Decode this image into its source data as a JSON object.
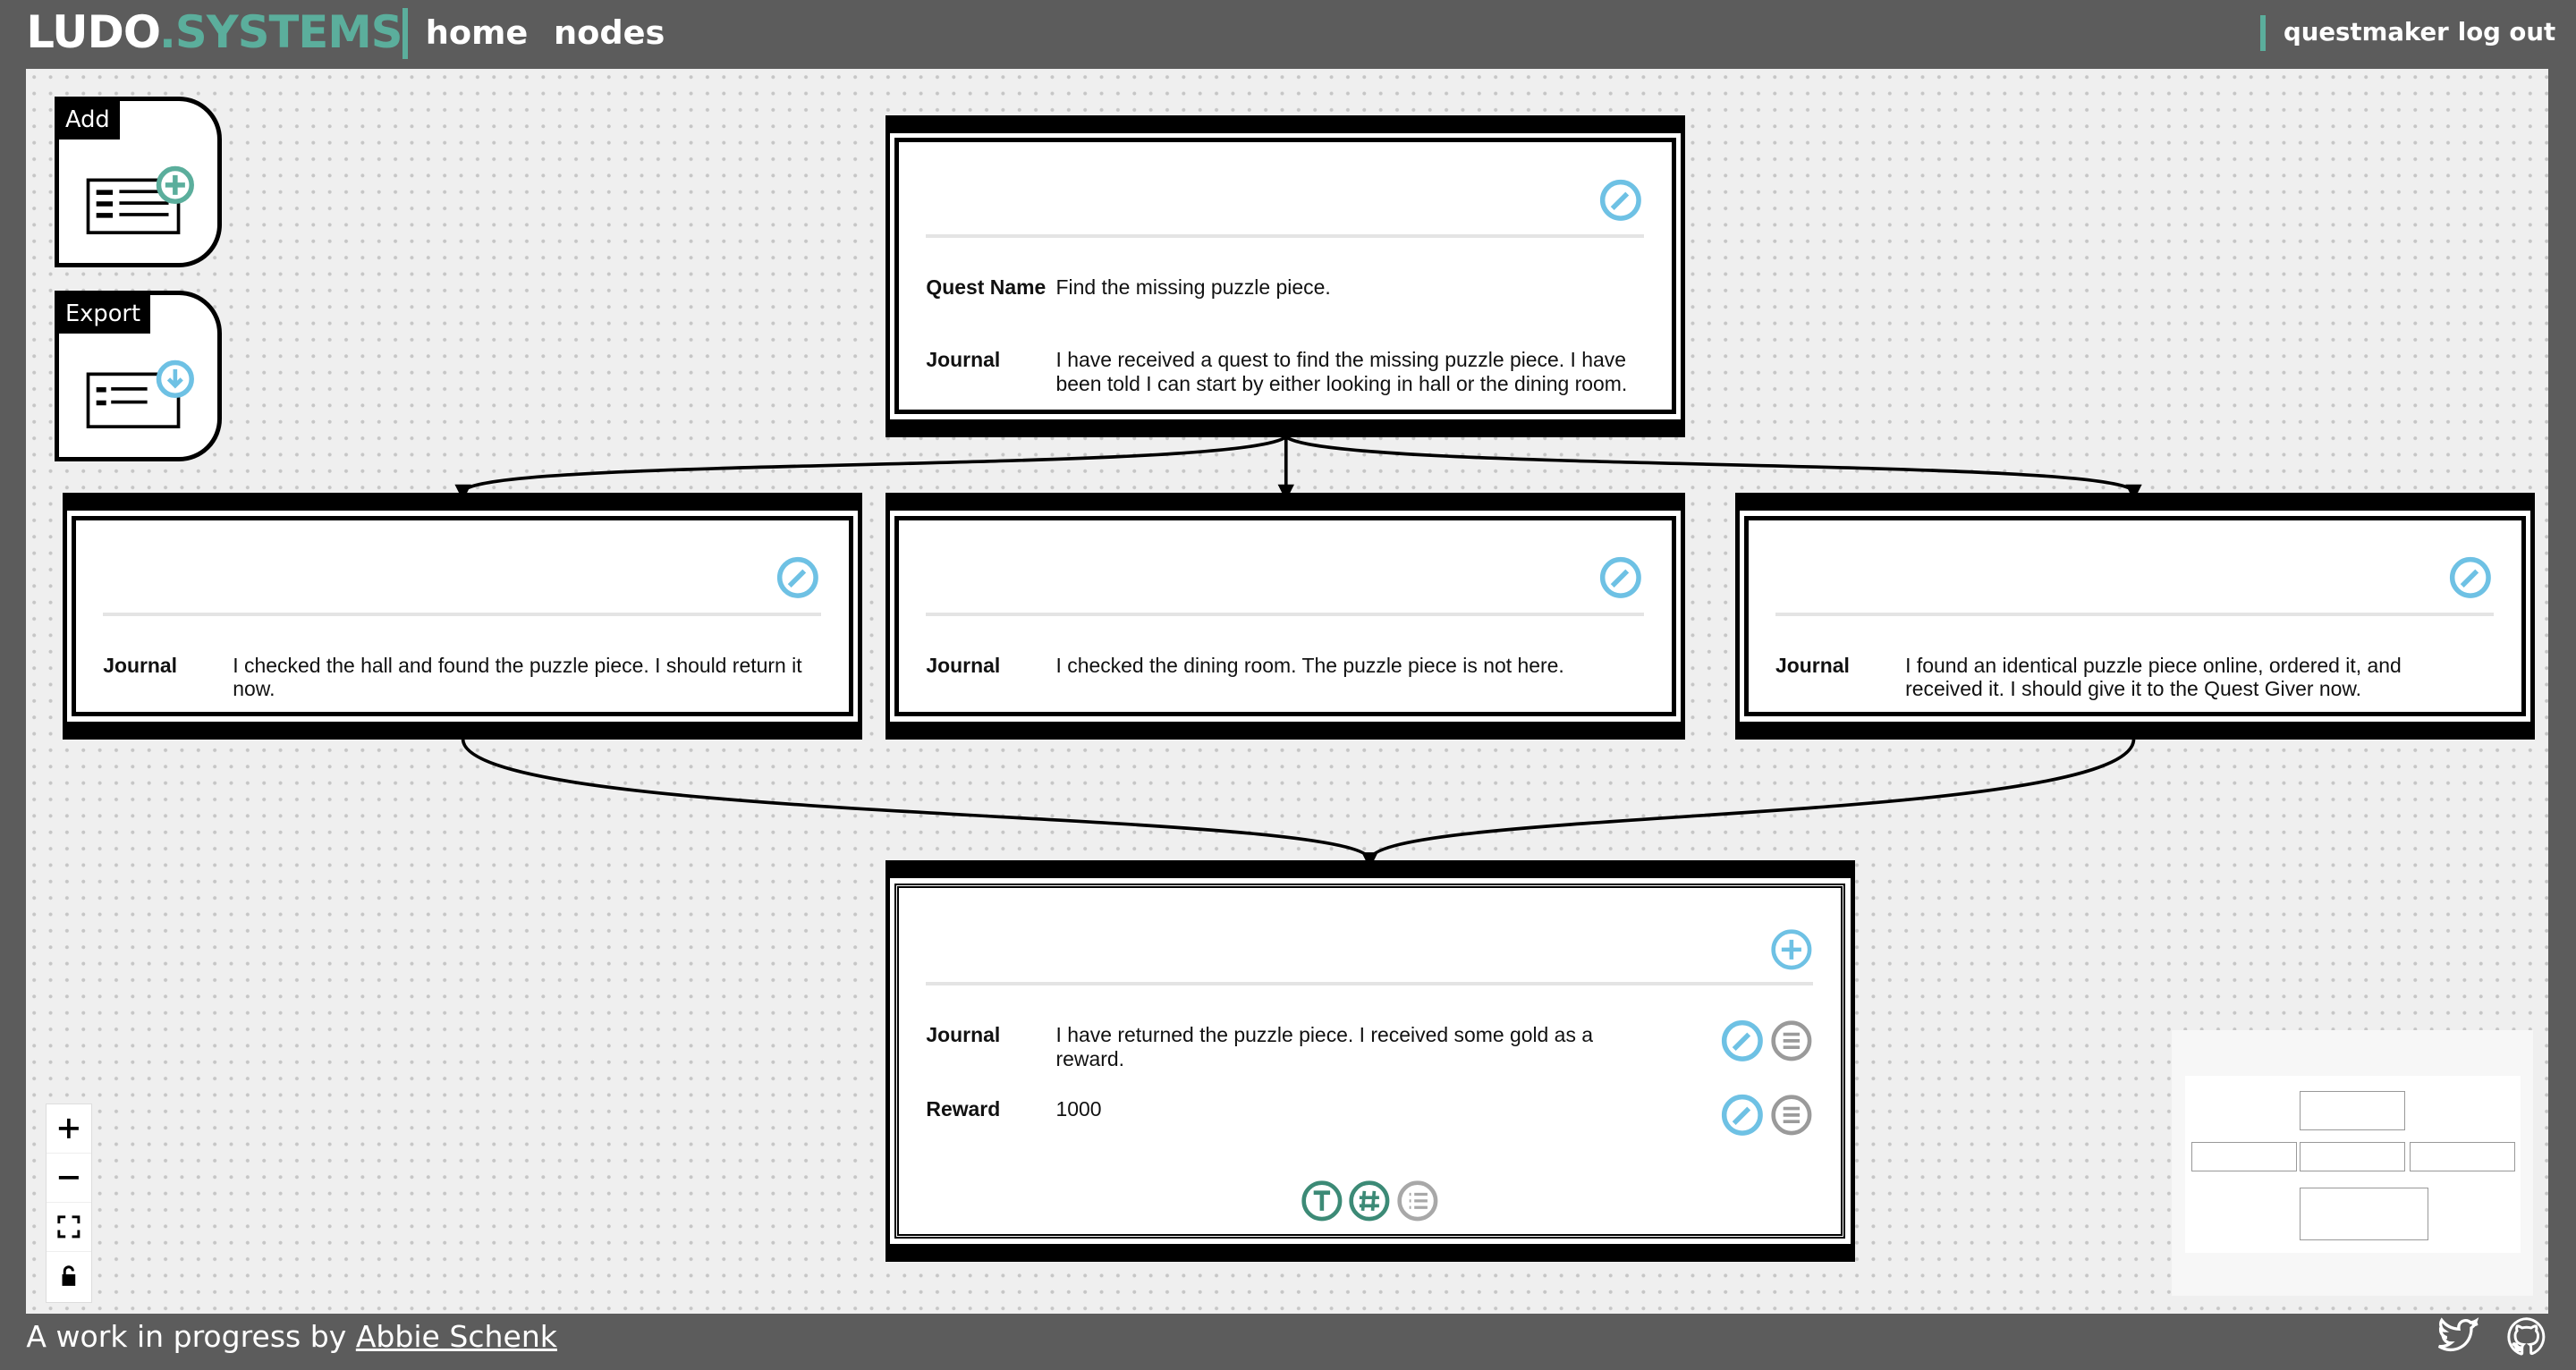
{
  "header": {
    "logo_part1": "LUDO",
    "logo_dot": ".",
    "logo_part2": "SYSTEMS",
    "nav_home": "home",
    "nav_nodes": "nodes",
    "user": "questmaker",
    "logout": "log out"
  },
  "toolbox": {
    "add_label": "Add",
    "export_label": "Export"
  },
  "nodes": {
    "root": {
      "quest_name_label": "Quest Name",
      "quest_name_value": "Find the missing puzzle piece.",
      "journal_label": "Journal",
      "journal_value": "I have received a quest to find the missing puzzle piece. I have been told I can start by either looking in hall or the dining room."
    },
    "hall": {
      "journal_label": "Journal",
      "journal_value": "I checked the hall and found the puzzle piece. I should return it now."
    },
    "dining": {
      "journal_label": "Journal",
      "journal_value": "I checked the dining room. The puzzle piece is not here."
    },
    "online": {
      "journal_label": "Journal",
      "journal_value": "I found an identical puzzle piece online, ordered it, and received it. I should give it to the Quest Giver now."
    },
    "final": {
      "journal_label": "Journal",
      "journal_value": "I have returned the puzzle piece. I received some gold as a reward.",
      "reward_label": "Reward",
      "reward_value": "1000"
    }
  },
  "footer": {
    "text": "A work in progress by",
    "author": "Abbie Schenk"
  },
  "colors": {
    "accent": "#5bae9c",
    "edit_blue": "#6ec1e4",
    "header_bg": "#5c5c5c",
    "canvas_bg": "#efefef",
    "grey_icon": "#9a9a9a"
  },
  "icons": {
    "edit": "pencil-circle-icon",
    "add_field": "plus-circle-icon",
    "menu": "list-circle-icon",
    "text_field": "text-t-icon",
    "number_field": "hash-icon",
    "list_field": "list-icon",
    "twitter": "twitter-bird-icon",
    "github": "github-octocat-icon"
  }
}
